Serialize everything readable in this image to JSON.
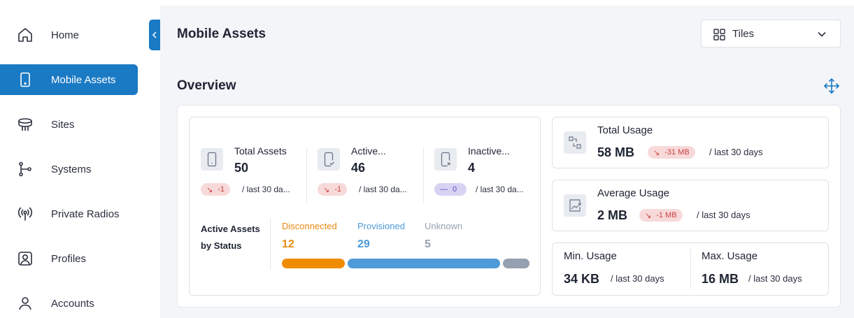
{
  "sidebar": {
    "items": [
      {
        "label": "Home",
        "icon": "home-icon",
        "active": false
      },
      {
        "label": "Mobile Assets",
        "icon": "mobile-device-icon",
        "active": true
      },
      {
        "label": "Sites",
        "icon": "site-tower-icon",
        "active": false
      },
      {
        "label": "Systems",
        "icon": "systems-icon",
        "active": false
      },
      {
        "label": "Private Radios",
        "icon": "radio-antenna-icon",
        "active": false
      },
      {
        "label": "Profiles",
        "icon": "profile-icon",
        "active": false
      },
      {
        "label": "Accounts",
        "icon": "user-icon",
        "active": false
      }
    ]
  },
  "header": {
    "title": "Mobile Assets",
    "view_select": {
      "value": "Tiles",
      "icon": "grid-icon"
    }
  },
  "overview": {
    "title": "Overview",
    "stats": [
      {
        "label": "Total Assets",
        "value": "50",
        "delta": "-1",
        "delta_trend": "down",
        "period": "/ last 30 da..."
      },
      {
        "label": "Active...",
        "value": "46",
        "delta": "-1",
        "delta_trend": "down",
        "period": "/ last 30 da..."
      },
      {
        "label": "Inactive...",
        "value": "4",
        "delta": "0",
        "delta_trend": "flat",
        "period": "/ last 30 da..."
      }
    ],
    "status": {
      "title_line1": "Active Assets",
      "title_line2": "by Status",
      "categories": [
        {
          "label": "Disconnected",
          "value": "12",
          "count": 12,
          "color": "#f08c00"
        },
        {
          "label": "Provisioned",
          "value": "29",
          "count": 29,
          "color": "#4f9ad8"
        },
        {
          "label": "Unknown",
          "value": "5",
          "count": 5,
          "color": "#97a0b0"
        }
      ]
    },
    "usage": {
      "total": {
        "label": "Total Usage",
        "value": "58 MB",
        "delta": "-31 MB",
        "period": "/ last 30 days"
      },
      "average": {
        "label": "Average Usage",
        "value": "2 MB",
        "delta": "-1 MB",
        "period": "/ last 30 days"
      },
      "min": {
        "label": "Min. Usage",
        "value": "34 KB",
        "period": "/ last 30 days"
      },
      "max": {
        "label": "Max. Usage",
        "value": "16 MB",
        "period": "/ last 30 days"
      }
    }
  },
  "colors": {
    "accent": "#1a7ac4",
    "delta_down_bg": "#f8d9d9",
    "delta_down_text": "#c94141",
    "delta_flat_bg": "#d8d3f3",
    "delta_flat_text": "#5a4fc2"
  }
}
